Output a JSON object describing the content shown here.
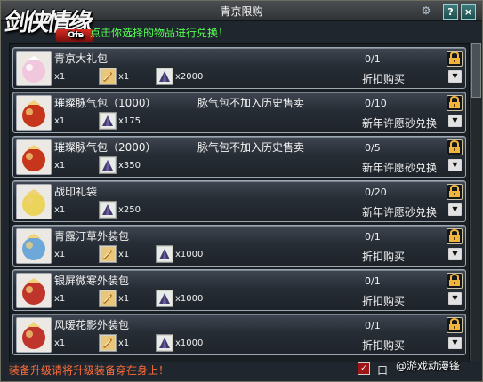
{
  "window": {
    "title": "青京限购",
    "logo_text": "剑侠情缘",
    "logo_badge": "Online",
    "instruction": "点击你选择的物品进行兑换！"
  },
  "top_buttons": {
    "help_label": "?",
    "close_label": "×"
  },
  "items": [
    {
      "name": "青京大礼包",
      "note": "",
      "costs": [
        {
          "icon": "scroll-icon",
          "label": "x1"
        },
        {
          "icon": "feather-icon",
          "label": "x1"
        },
        {
          "icon": "cone-icon",
          "label": "x2000"
        }
      ],
      "limit": "0/1",
      "buy_type": "折扣购买",
      "icon_color": "#f0c7dc"
    },
    {
      "name": "璀璨脉气包（1000）",
      "note": "脉气包不加入历史售卖",
      "costs": [
        {
          "icon": "scroll-icon",
          "label": "x1"
        },
        {
          "icon": "cone-icon",
          "label": "x175"
        }
      ],
      "limit": "0/10",
      "buy_type": "新年许愿砂兑换",
      "icon_color": "#c6361c"
    },
    {
      "name": "璀璨脉气包（2000）",
      "note": "脉气包不加入历史售卖",
      "costs": [
        {
          "icon": "scroll-icon",
          "label": "x1"
        },
        {
          "icon": "cone-icon",
          "label": "x350"
        }
      ],
      "limit": "0/5",
      "buy_type": "新年许愿砂兑换",
      "icon_color": "#c6361c"
    },
    {
      "name": "战印礼袋",
      "note": "",
      "costs": [
        {
          "icon": "scroll-icon",
          "label": "x1"
        },
        {
          "icon": "cone-icon",
          "label": "x250"
        }
      ],
      "limit": "0/20",
      "buy_type": "新年许愿砂兑换",
      "icon_color": "#ead45a"
    },
    {
      "name": "青露汀草外装包",
      "note": "",
      "costs": [
        {
          "icon": "scroll-icon",
          "label": "x1"
        },
        {
          "icon": "feather-icon",
          "label": "x1"
        },
        {
          "icon": "cone-icon",
          "label": "x1000"
        }
      ],
      "limit": "0/1",
      "buy_type": "折扣购买",
      "icon_color": "#6da8d8"
    },
    {
      "name": "银屏微寒外装包",
      "note": "",
      "costs": [
        {
          "icon": "scroll-icon",
          "label": "x1"
        },
        {
          "icon": "feather-icon",
          "label": "x1"
        },
        {
          "icon": "cone-icon",
          "label": "x1000"
        }
      ],
      "limit": "0/1",
      "buy_type": "折扣购买",
      "icon_color": "#c0352b"
    },
    {
      "name": "风暖花影外装包",
      "note": "",
      "costs": [
        {
          "icon": "scroll-icon",
          "label": "x1"
        },
        {
          "icon": "feather-icon",
          "label": "x1"
        },
        {
          "icon": "cone-icon",
          "label": "x1000"
        }
      ],
      "limit": "0/1",
      "buy_type": "折扣购买",
      "icon_color": "#c0352b"
    }
  ],
  "footer": {
    "warning": "装备升级请将升级装备穿在身上！",
    "checkbox_label": "口",
    "watermark": "@游戏动漫锋"
  },
  "colors": {
    "accent_green": "#55ff55",
    "warning": "#ff6d3c",
    "checkbox": "#9f1515"
  }
}
